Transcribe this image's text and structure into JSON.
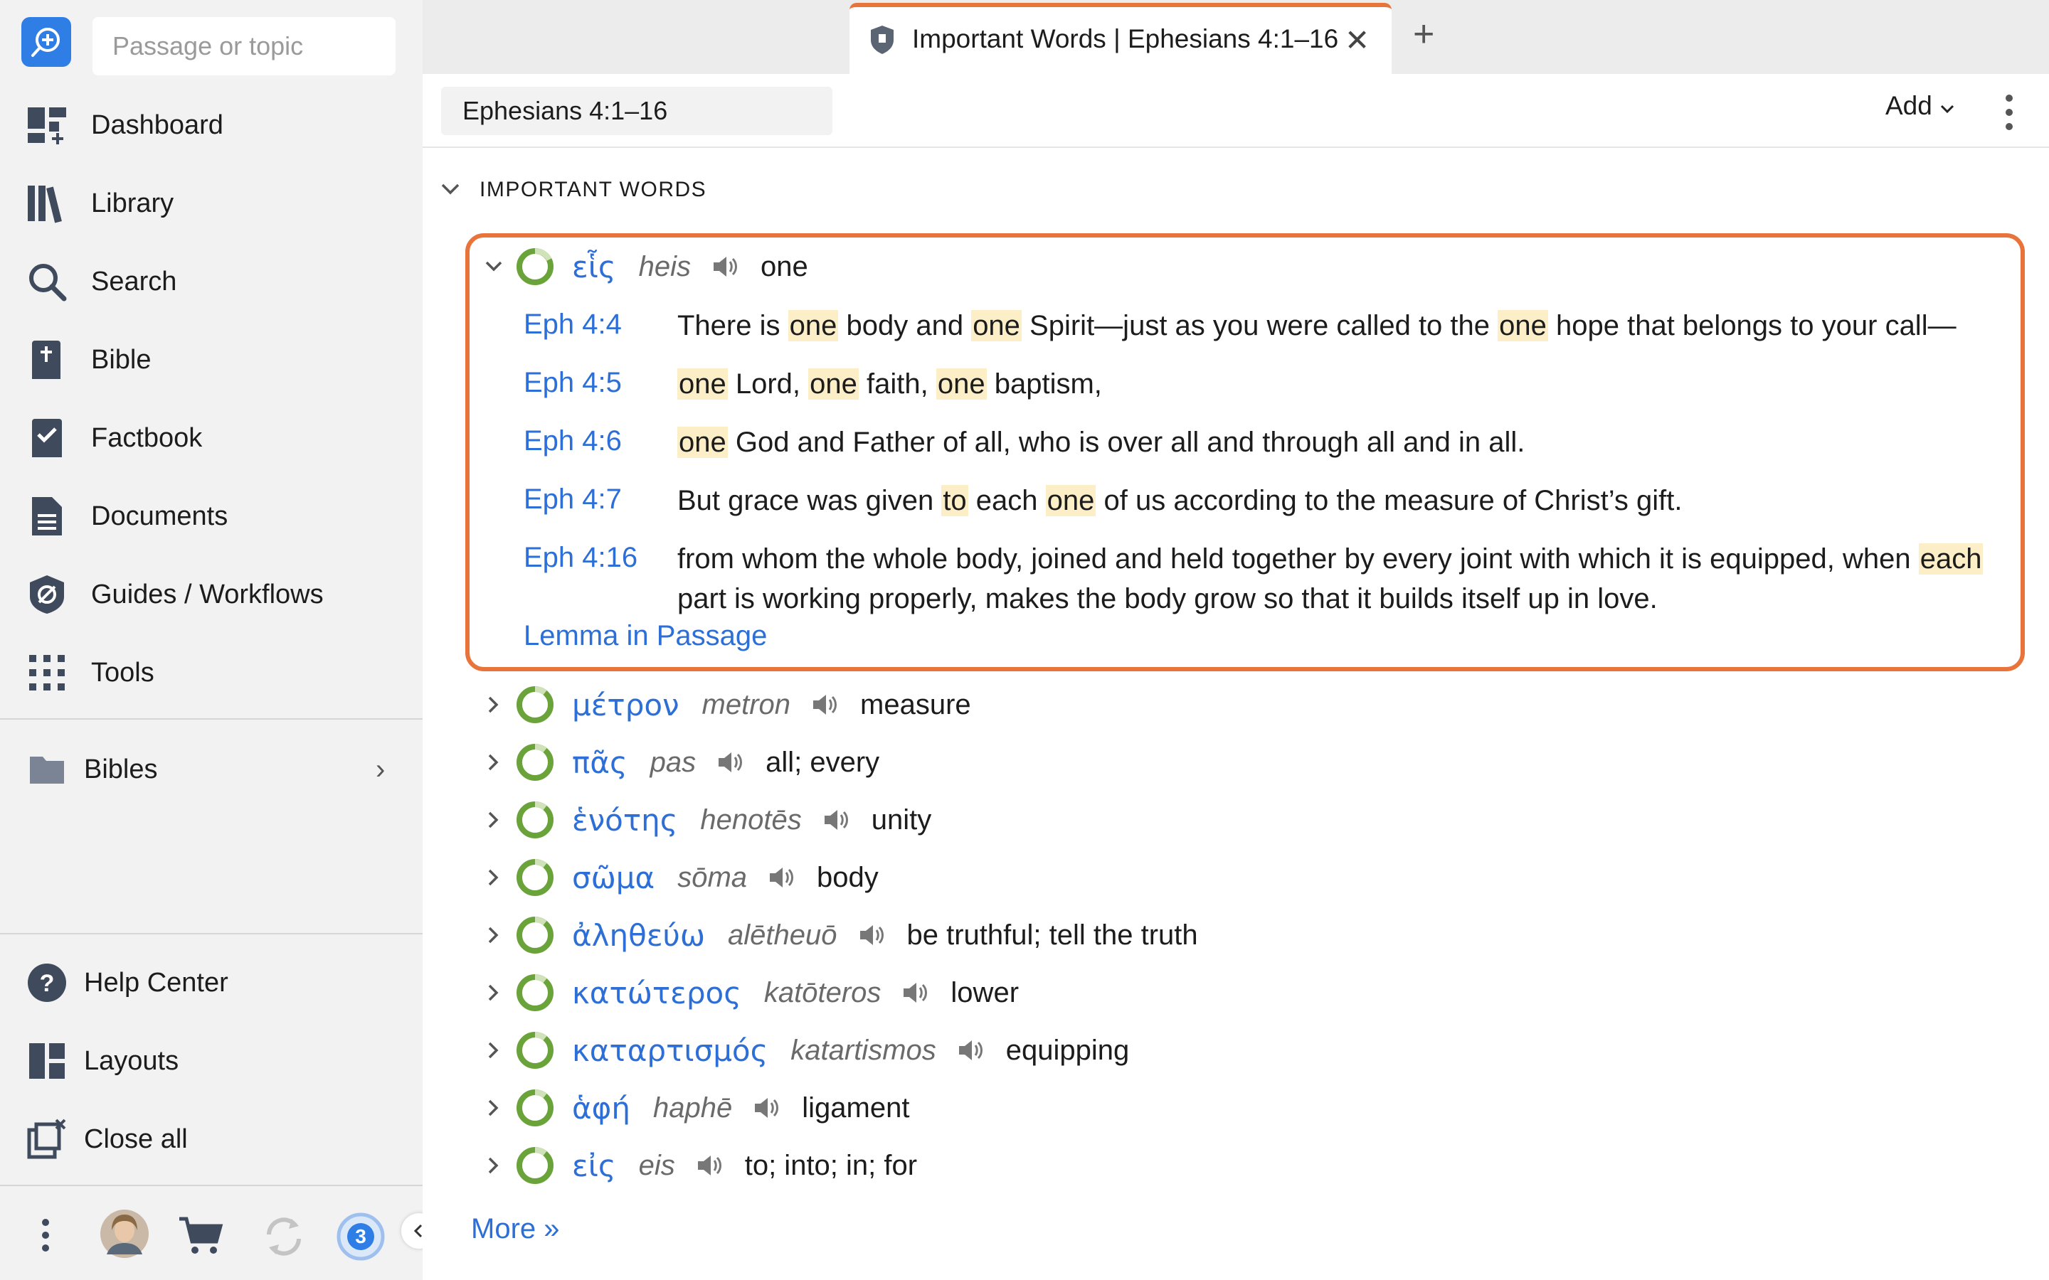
{
  "sidebar": {
    "search_placeholder": "Passage or topic",
    "items": [
      {
        "label": "Dashboard"
      },
      {
        "label": "Library"
      },
      {
        "label": "Search"
      },
      {
        "label": "Bible"
      },
      {
        "label": "Factbook"
      },
      {
        "label": "Documents"
      },
      {
        "label": "Guides / Workflows"
      },
      {
        "label": "Tools"
      }
    ],
    "bibles": {
      "label": "Bibles"
    },
    "bottom_items": [
      {
        "label": "Help Center"
      },
      {
        "label": "Layouts"
      },
      {
        "label": "Close all"
      }
    ],
    "notification_count": "3"
  },
  "tab": {
    "title": "Important Words | Ephesians 4:1–16"
  },
  "panel": {
    "reference": "Ephesians 4:1–16",
    "add_label": "Add",
    "section_title": "IMPORTANT WORDS",
    "expanded": {
      "lemma": "εἷς",
      "translit": "heis",
      "gloss": "one",
      "verses": [
        {
          "ref": "Eph 4:4"
        },
        {
          "ref": "Eph 4:5"
        },
        {
          "ref": "Eph 4:6"
        },
        {
          "ref": "Eph 4:7"
        },
        {
          "ref": "Eph 4:16"
        }
      ],
      "lemma_link": "Lemma in Passage"
    },
    "words": [
      {
        "lemma": "μέτρον",
        "translit": "metron",
        "gloss": "measure"
      },
      {
        "lemma": "πᾶς",
        "translit": "pas",
        "gloss": "all; every"
      },
      {
        "lemma": "ἑνότης",
        "translit": "henotēs",
        "gloss": "unity"
      },
      {
        "lemma": "σῶμα",
        "translit": "sōma",
        "gloss": "body"
      },
      {
        "lemma": "ἀληθεύω",
        "translit": "alētheuō",
        "gloss": "be truthful; tell the truth"
      },
      {
        "lemma": "κατώτερος",
        "translit": "katōteros",
        "gloss": "lower"
      },
      {
        "lemma": "καταρτισμός",
        "translit": "katartismos",
        "gloss": "equipping"
      },
      {
        "lemma": "ἁφή",
        "translit": "haphē",
        "gloss": "ligament"
      },
      {
        "lemma": "εἰς",
        "translit": "eis",
        "gloss": "to; into; in; for"
      }
    ],
    "more_label": "More »"
  },
  "colors": {
    "accent": "#e8743b",
    "link": "#2d6fd6",
    "highlight": "#fcefc8",
    "ring": "#6aa33a",
    "logo": "#2f7ee6"
  }
}
